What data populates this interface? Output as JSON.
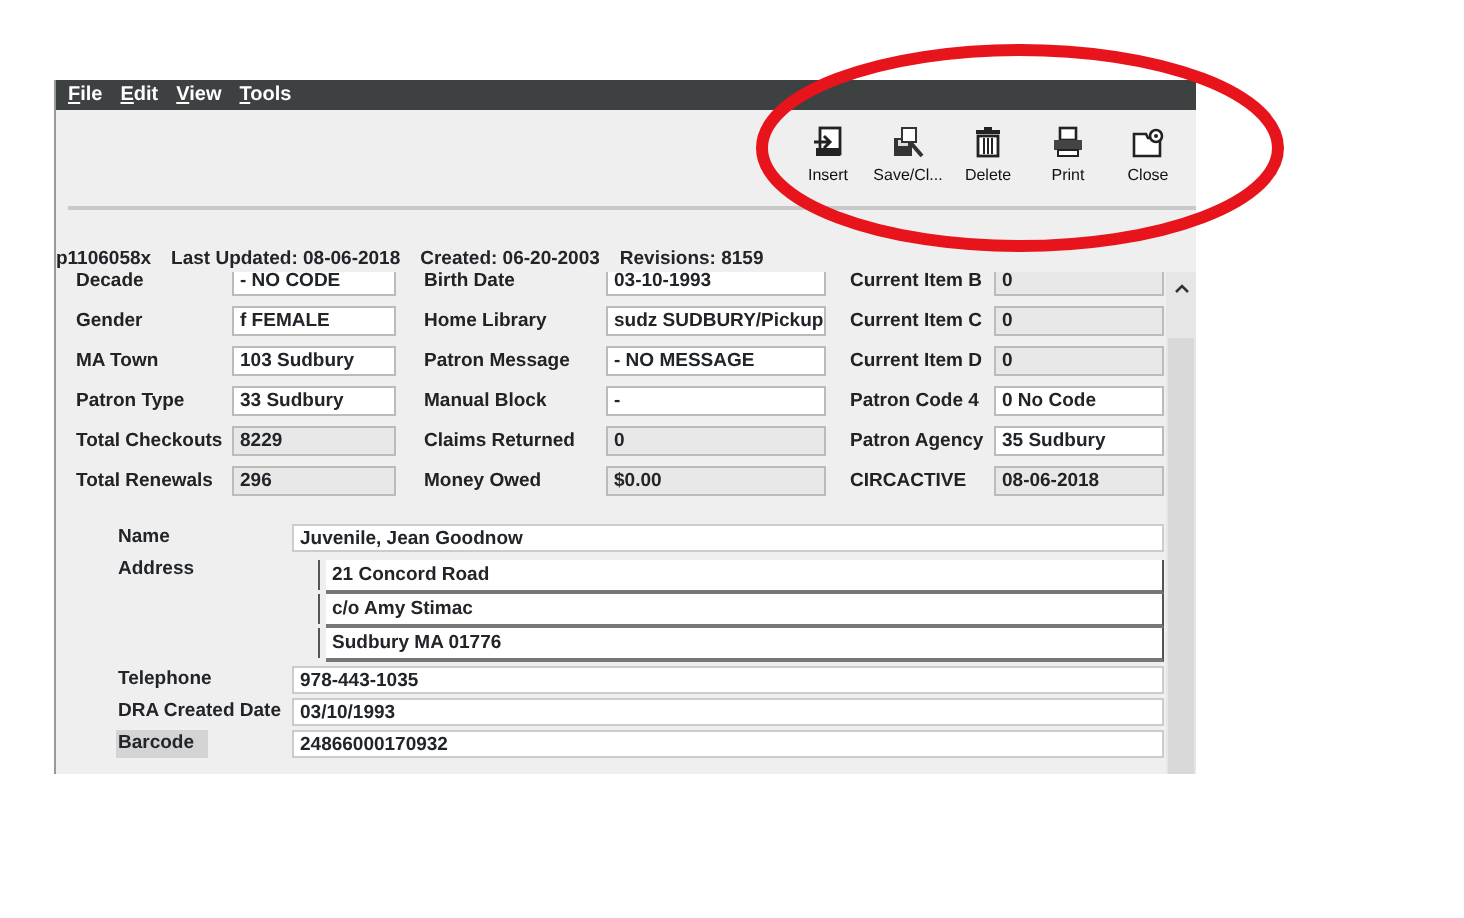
{
  "menu": [
    "File",
    "Edit",
    "View",
    "Tools"
  ],
  "toolbar": [
    {
      "kind": "insert",
      "label": "Insert"
    },
    {
      "kind": "save",
      "label": "Save/Cl..."
    },
    {
      "kind": "delete",
      "label": "Delete"
    },
    {
      "kind": "print",
      "label": "Print"
    },
    {
      "kind": "close",
      "label": "Close"
    }
  ],
  "status": {
    "id": "p1106058x",
    "last_updated": "Last Updated: 08-06-2018",
    "created": "Created: 06-20-2003",
    "revisions": "Revisions: 8159"
  },
  "grid": [
    [
      {
        "label": "Decade",
        "value": "-  NO CODE",
        "editable": true
      },
      {
        "label": "Birth Date",
        "value": "03-10-1993",
        "editable": true
      },
      {
        "label": "Current Item B",
        "value": "0",
        "editable": false
      }
    ],
    [
      {
        "label": "Gender",
        "value": "f  FEMALE",
        "editable": true
      },
      {
        "label": "Home Library",
        "value": "sudz   SUDBURY/Pickup",
        "editable": true
      },
      {
        "label": "Current Item C",
        "value": "0",
        "editable": false
      }
    ],
    [
      {
        "label": "MA Town",
        "value": "103  Sudbury",
        "editable": true
      },
      {
        "label": "Patron Message",
        "value": "-  NO MESSAGE",
        "editable": true
      },
      {
        "label": "Current Item D",
        "value": "0",
        "editable": false
      }
    ],
    [
      {
        "label": "Patron Type",
        "value": "33  Sudbury",
        "editable": true
      },
      {
        "label": "Manual Block",
        "value": "-",
        "editable": true
      },
      {
        "label": "Patron Code 4",
        "value": "0  No Code",
        "editable": true
      }
    ],
    [
      {
        "label": "Total Checkouts",
        "value": "8229",
        "editable": false
      },
      {
        "label": "Claims Returned",
        "value": "0",
        "editable": false
      },
      {
        "label": "Patron Agency",
        "value": "35  Sudbury",
        "editable": true
      }
    ],
    [
      {
        "label": "Total Renewals",
        "value": "296",
        "editable": false
      },
      {
        "label": "Money Owed",
        "value": "$0.00",
        "editable": false
      },
      {
        "label": "CIRCACTIVE",
        "value": "08-06-2018",
        "editable": false
      }
    ]
  ],
  "details": [
    {
      "label": "Name",
      "lines": [
        "Juvenile, Jean Goodnow"
      ],
      "kind": "plain",
      "highlighted": false
    },
    {
      "label": "Address",
      "lines": [
        "21 Concord Road",
        "c/o Amy Stimac",
        "Sudbury MA 01776"
      ],
      "kind": "address",
      "highlighted": false
    },
    {
      "label": "Telephone",
      "lines": [
        "978-443-1035"
      ],
      "kind": "plain",
      "highlighted": false
    },
    {
      "label": "DRA Created Date",
      "lines": [
        "03/10/1993"
      ],
      "kind": "plain",
      "highlighted": false
    },
    {
      "label": "Barcode",
      "lines": [
        "24866000170932"
      ],
      "kind": "plain",
      "highlighted": true
    }
  ]
}
